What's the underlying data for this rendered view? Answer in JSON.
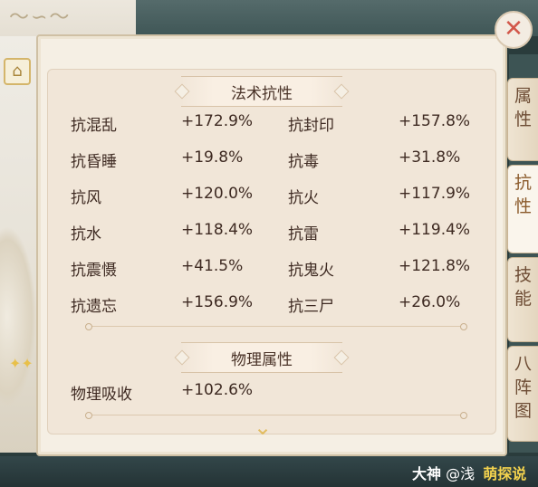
{
  "home": {
    "icon": "home-icon"
  },
  "close": {
    "icon": "close-icon",
    "glyph": "✕"
  },
  "sections": {
    "magic": {
      "title": "法术抗性",
      "rows": [
        {
          "n1": "抗混乱",
          "v1": "+172.9%",
          "n2": "抗封印",
          "v2": "+157.8%"
        },
        {
          "n1": "抗昏睡",
          "v1": "+19.8%",
          "n2": "抗毒",
          "v2": "+31.8%"
        },
        {
          "n1": "抗风",
          "v1": "+120.0%",
          "n2": "抗火",
          "v2": "+117.9%"
        },
        {
          "n1": "抗水",
          "v1": "+118.4%",
          "n2": "抗雷",
          "v2": "+119.4%"
        },
        {
          "n1": "抗震慑",
          "v1": "+41.5%",
          "n2": "抗鬼火",
          "v2": "+121.8%"
        },
        {
          "n1": "抗遗忘",
          "v1": "+156.9%",
          "n2": "抗三尸",
          "v2": "+26.0%"
        }
      ]
    },
    "physical": {
      "title": "物理属性",
      "rows": [
        {
          "n1": "物理吸收",
          "v1": "+102.6%"
        }
      ]
    }
  },
  "tabs": [
    {
      "c1": "属",
      "c2": "性"
    },
    {
      "c1": "抗",
      "c2": "性"
    },
    {
      "c1": "技",
      "c2": "能"
    },
    {
      "c1": "八",
      "c2": "阵",
      "c3": "图"
    }
  ],
  "watermark": {
    "brand": "大神",
    "handle": "@浅",
    "stamp": "萌探说"
  },
  "colors": {
    "accent": "#e2bd62",
    "text": "#3e2a22",
    "close": "#d2574a"
  }
}
